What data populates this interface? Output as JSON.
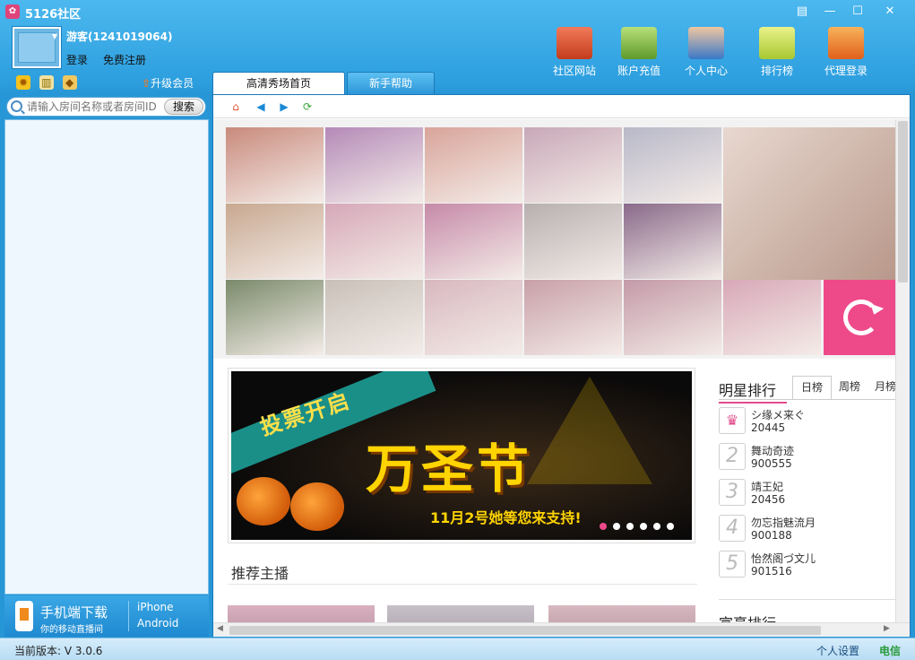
{
  "window": {
    "title": "5126社区",
    "controls": [
      "skin-icon",
      "minimize-icon",
      "maximize-icon",
      "close-icon"
    ]
  },
  "user": {
    "name": "游客(1241019064)",
    "login_label": "登录",
    "register_label": "免费注册",
    "upgrade_label": "升级会员"
  },
  "topnav": [
    {
      "label": "社区网站",
      "icon": "house-icon",
      "color": "#e0563a"
    },
    {
      "label": "账户充值",
      "icon": "money-icon",
      "color": "#7fb24a"
    },
    {
      "label": "个人中心",
      "icon": "people-icon",
      "color": "#3a78c8"
    },
    {
      "label": "排行榜",
      "icon": "podium-icon",
      "color": "#c8e04a"
    },
    {
      "label": "代理登录",
      "icon": "arrow-down-icon",
      "color": "#f08a1c"
    }
  ],
  "tabs": [
    {
      "label": "高清秀场首页",
      "active": true
    },
    {
      "label": "新手帮助",
      "active": false
    }
  ],
  "search": {
    "placeholder": "请输入房间名称或者房间ID",
    "button_label": "搜索"
  },
  "mobile": {
    "title": "手机端下载",
    "subtitle": "你的移动直播间",
    "iphone": "iPhone",
    "android": "Android"
  },
  "banner": {
    "vote_text": "投票开启",
    "big_text": "万圣节",
    "sub_text": "11月2号她等您来支持!"
  },
  "recommend_title": "推荐主播",
  "star_rank": {
    "title": "明星排行",
    "tabs": [
      "日榜",
      "周榜",
      "月榜"
    ],
    "items": [
      {
        "rank": "♛",
        "name": "シ缘メ来ぐ",
        "score": "20445"
      },
      {
        "rank": "2",
        "name": "舞动奇迹",
        "score": "900555"
      },
      {
        "rank": "3",
        "name": "靖王妃",
        "score": "20456"
      },
      {
        "rank": "4",
        "name": "勿忘指魅流月",
        "score": "900188"
      },
      {
        "rank": "5",
        "name": "怡然阁づ文儿",
        "score": "901516"
      }
    ]
  },
  "rich_rank": {
    "title": "富豪排行"
  },
  "status": {
    "version": "当前版本: V 3.0.6",
    "settings": "个人设置",
    "telecom": "电信"
  },
  "photo_colors": [
    "#c98a7c",
    "#b48ab8",
    "#d8a49a",
    "#c8a8b8",
    "#b8b8c8",
    "#c8a890",
    "#d6a8b8",
    "#c68aa8",
    "#b8b0b0",
    "#8a6a8a",
    "#7a8a6a",
    "#c8c0b8",
    "#d8b8c0",
    "#c8a0a8",
    "#c49aa8",
    "#d8a8b8",
    "#d8c0c0"
  ]
}
